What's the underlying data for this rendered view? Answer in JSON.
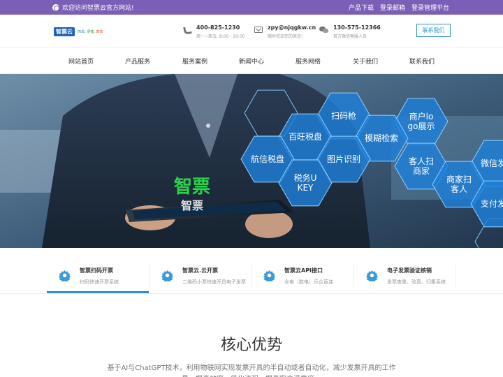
{
  "topbar": {
    "welcome": "欢迎访问智票云官方网站!",
    "links": [
      "产品下载",
      "登录邮箱",
      "登录管理平台"
    ]
  },
  "header": {
    "logo_text": "智票云",
    "logo_slogan": [
      "简单",
      "便捷",
      "高效"
    ],
    "contacts": [
      {
        "icon": "phone-icon",
        "main": "400-825-1230",
        "sub": "周一~周五, 8:00 - 20:00"
      },
      {
        "icon": "mail-icon",
        "main": "zpy@njqgkw.cn",
        "sub": "随时欢迎您的来信!"
      },
      {
        "icon": "chat-icon",
        "main": "130-575-12366",
        "sub": "官方微信客服人员"
      }
    ],
    "contact_button": "联系我们"
  },
  "nav": {
    "items": [
      "网站首页",
      "产品服务",
      "服务案例",
      "新闻中心",
      "服务网络",
      "关于我们",
      "联系我们"
    ]
  },
  "banner": {
    "hexagons": [
      "扫码枪",
      "商户logo展示",
      "百旺税盘",
      "模糊检索",
      "航信税盘",
      "图片识别",
      "客人扫商家",
      "微信发票",
      "税务UKEY",
      "商家扫客人",
      "支付发票"
    ],
    "tablet_brand_top": "智票",
    "tablet_brand_bottom": "智票"
  },
  "services": [
    {
      "title": "智票扫码开票",
      "desc": "扫码快速开票系统"
    },
    {
      "title": "智票云.云开票",
      "desc": "二维码小票快速开具电子发票"
    },
    {
      "title": "智票云API接口",
      "desc": "全电（数电）乐企直连"
    },
    {
      "title": "电子发票验证核销",
      "desc": "发票查重、验真、归集系统"
    }
  ],
  "core": {
    "title": "核心优势",
    "desc": "基于AI与ChatGPT技术，利用物联网实现发票开具的半自动或者自动化，减少发票开具的工作量，提高效率，简化流程，提高客户满意度。"
  },
  "colors": {
    "topbar": "#7b5fb6",
    "accent": "#2a8fd6",
    "hex_fill": "#1e7fd8"
  }
}
